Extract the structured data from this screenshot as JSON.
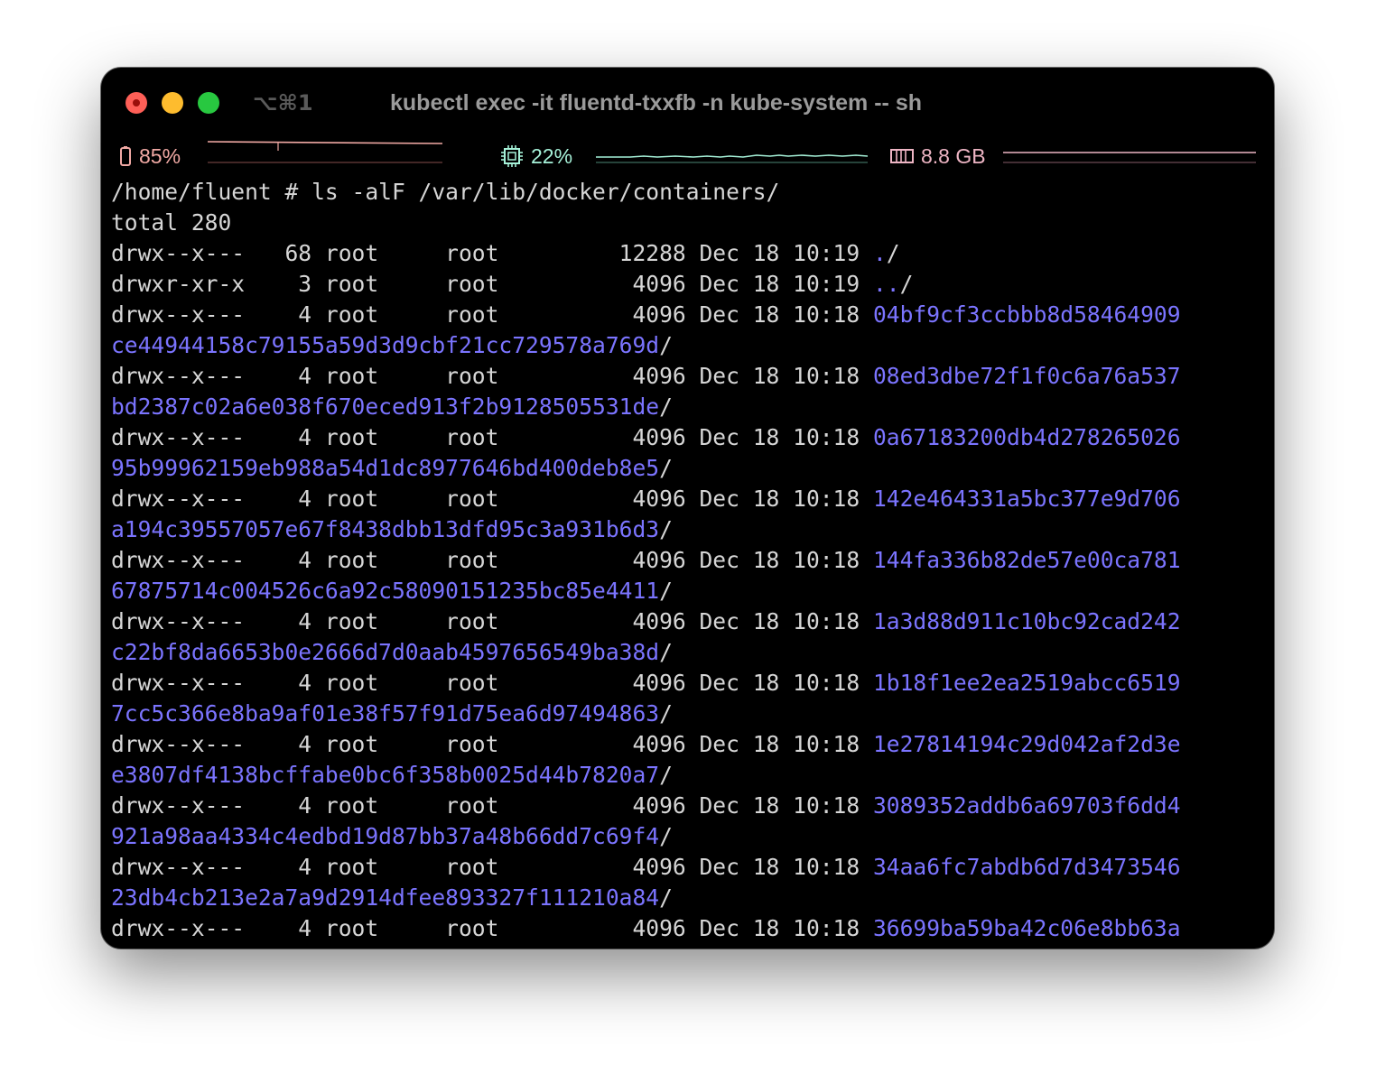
{
  "window": {
    "shortcut": "⌥⌘1",
    "title": "kubectl exec -it fluentd-txxfb -n kube-system -- sh"
  },
  "status": {
    "battery": {
      "icon": "battery-icon",
      "value": "85%",
      "level": 0.85,
      "color": "#f1a9a4"
    },
    "cpu": {
      "icon": "cpu-icon",
      "value": "22%",
      "level": 0.22,
      "color": "#a6f2d9"
    },
    "memory": {
      "icon": "memory-icon",
      "value": "8.8 GB",
      "color": "#eeb5c4"
    }
  },
  "terminal": {
    "colors": {
      "text": "#d6d6d6",
      "directory": "#7b74ff",
      "background": "#000000"
    },
    "lines": [
      {
        "prefix": "/home/fluent # ls -alF /var/lib/docker/containers/",
        "dir": "",
        "suffix": ""
      },
      {
        "prefix": "total 280",
        "dir": "",
        "suffix": ""
      },
      {
        "prefix": "drwx--x---   68 root     root         12288 Dec 18 10:19 ",
        "dir": ".",
        "suffix": "/"
      },
      {
        "prefix": "drwxr-xr-x    3 root     root          4096 Dec 18 10:19 ",
        "dir": "..",
        "suffix": "/"
      },
      {
        "prefix": "drwx--x---    4 root     root          4096 Dec 18 10:18 ",
        "dir": "04bf9cf3ccbbb8d58464909",
        "suffix": ""
      },
      {
        "prefix": "",
        "dir": "ce44944158c79155a59d3d9cbf21cc729578a769d",
        "suffix": "/"
      },
      {
        "prefix": "drwx--x---    4 root     root          4096 Dec 18 10:18 ",
        "dir": "08ed3dbe72f1f0c6a76a537",
        "suffix": ""
      },
      {
        "prefix": "",
        "dir": "bd2387c02a6e038f670eced913f2b9128505531de",
        "suffix": "/"
      },
      {
        "prefix": "drwx--x---    4 root     root          4096 Dec 18 10:18 ",
        "dir": "0a67183200db4d278265026",
        "suffix": ""
      },
      {
        "prefix": "",
        "dir": "95b99962159eb988a54d1dc8977646bd400deb8e5",
        "suffix": "/"
      },
      {
        "prefix": "drwx--x---    4 root     root          4096 Dec 18 10:18 ",
        "dir": "142e464331a5bc377e9d706",
        "suffix": ""
      },
      {
        "prefix": "",
        "dir": "a194c39557057e67f8438dbb13dfd95c3a931b6d3",
        "suffix": "/"
      },
      {
        "prefix": "drwx--x---    4 root     root          4096 Dec 18 10:18 ",
        "dir": "144fa336b82de57e00ca781",
        "suffix": ""
      },
      {
        "prefix": "",
        "dir": "67875714c004526c6a92c58090151235bc85e4411",
        "suffix": "/"
      },
      {
        "prefix": "drwx--x---    4 root     root          4096 Dec 18 10:18 ",
        "dir": "1a3d88d911c10bc92cad242",
        "suffix": ""
      },
      {
        "prefix": "",
        "dir": "c22bf8da6653b0e2666d7d0aab4597656549ba38d",
        "suffix": "/"
      },
      {
        "prefix": "drwx--x---    4 root     root          4096 Dec 18 10:18 ",
        "dir": "1b18f1ee2ea2519abcc6519",
        "suffix": ""
      },
      {
        "prefix": "",
        "dir": "7cc5c366e8ba9af01e38f57f91d75ea6d97494863",
        "suffix": "/"
      },
      {
        "prefix": "drwx--x---    4 root     root          4096 Dec 18 10:18 ",
        "dir": "1e27814194c29d042af2d3e",
        "suffix": ""
      },
      {
        "prefix": "",
        "dir": "e3807df4138bcffabe0bc6f358b0025d44b7820a7",
        "suffix": "/"
      },
      {
        "prefix": "drwx--x---    4 root     root          4096 Dec 18 10:18 ",
        "dir": "3089352addb6a69703f6dd4",
        "suffix": ""
      },
      {
        "prefix": "",
        "dir": "921a98aa4334c4edbd19d87bb37a48b66dd7c69f4",
        "suffix": "/"
      },
      {
        "prefix": "drwx--x---    4 root     root          4096 Dec 18 10:18 ",
        "dir": "34aa6fc7abdb6d7d3473546",
        "suffix": ""
      },
      {
        "prefix": "",
        "dir": "23db4cb213e2a7a9d2914dfee893327f111210a84",
        "suffix": "/"
      },
      {
        "prefix": "drwx--x---    4 root     root          4096 Dec 18 10:18 ",
        "dir": "36699ba59ba42c06e8bb63a",
        "suffix": ""
      }
    ]
  }
}
